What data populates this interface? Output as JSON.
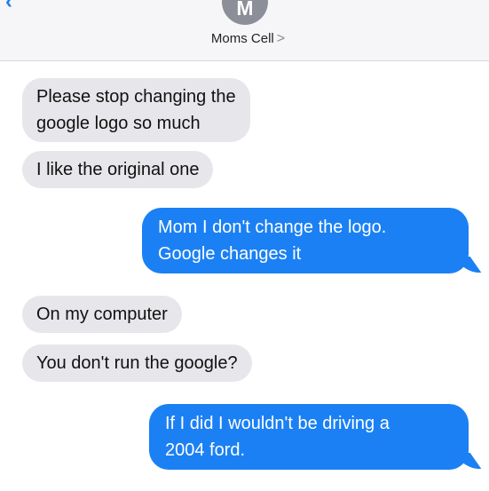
{
  "header": {
    "contact_name": "Moms Cell",
    "avatar_initial": "M",
    "back_symbol": "‹",
    "chevron_symbol": ">"
  },
  "messages": [
    {
      "direction": "incoming",
      "lines": [
        "Please stop changing the",
        "google logo so much"
      ]
    },
    {
      "direction": "incoming",
      "lines": [
        "I like the original one"
      ]
    },
    {
      "direction": "outgoing",
      "lines": [
        "Mom I don't change the logo.",
        "Google changes it"
      ]
    },
    {
      "direction": "incoming",
      "lines": [
        "On my computer"
      ]
    },
    {
      "direction": "incoming",
      "lines": [
        "You don't run the google?"
      ]
    },
    {
      "direction": "outgoing",
      "lines": [
        "If I did I wouldn't be driving a",
        "2004 ford."
      ]
    }
  ],
  "colors": {
    "incoming_bubble": "#e7e7eb",
    "outgoing_bubble": "#1b80f4",
    "accent": "#1e7cf2"
  }
}
